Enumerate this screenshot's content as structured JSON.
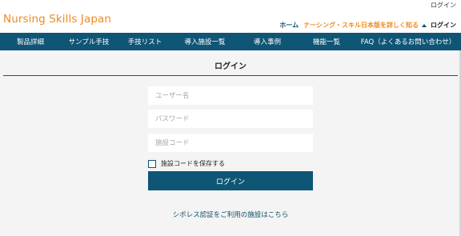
{
  "utility": {
    "login_link": "ログイン"
  },
  "header": {
    "logo_text": "Nursing Skills Japan",
    "home_link": "ホーム",
    "learn_more_link": "ナーシング・スキル日本版を詳しく知る",
    "login_link": "ログイン",
    "icons": {
      "learn_more_indicator": "triangle-up-icon"
    }
  },
  "nav": {
    "items": [
      {
        "label": "製品詳細"
      },
      {
        "label": "サンプル手技"
      },
      {
        "label": "手技リスト"
      },
      {
        "label": "導入施設一覧"
      },
      {
        "label": "導入事例"
      },
      {
        "label": "機能一覧"
      },
      {
        "label": "FAQ（よくあるお問い合わせ）"
      }
    ]
  },
  "main": {
    "title": "ログイン",
    "form": {
      "username": {
        "placeholder": "ユーザー名",
        "value": ""
      },
      "password": {
        "placeholder": "パスワード",
        "value": ""
      },
      "facility_code": {
        "placeholder": "施設コード",
        "value": ""
      },
      "remember_label": "施設コードを保存する",
      "remember_checked": false,
      "submit_label": "ログイン"
    },
    "cybozu_link": "シボレス認証をご利用の施設はこちら"
  },
  "colors": {
    "brand_orange": "#f08a1c",
    "primary_navy": "#0f5575",
    "background": "#f4f4f4"
  }
}
